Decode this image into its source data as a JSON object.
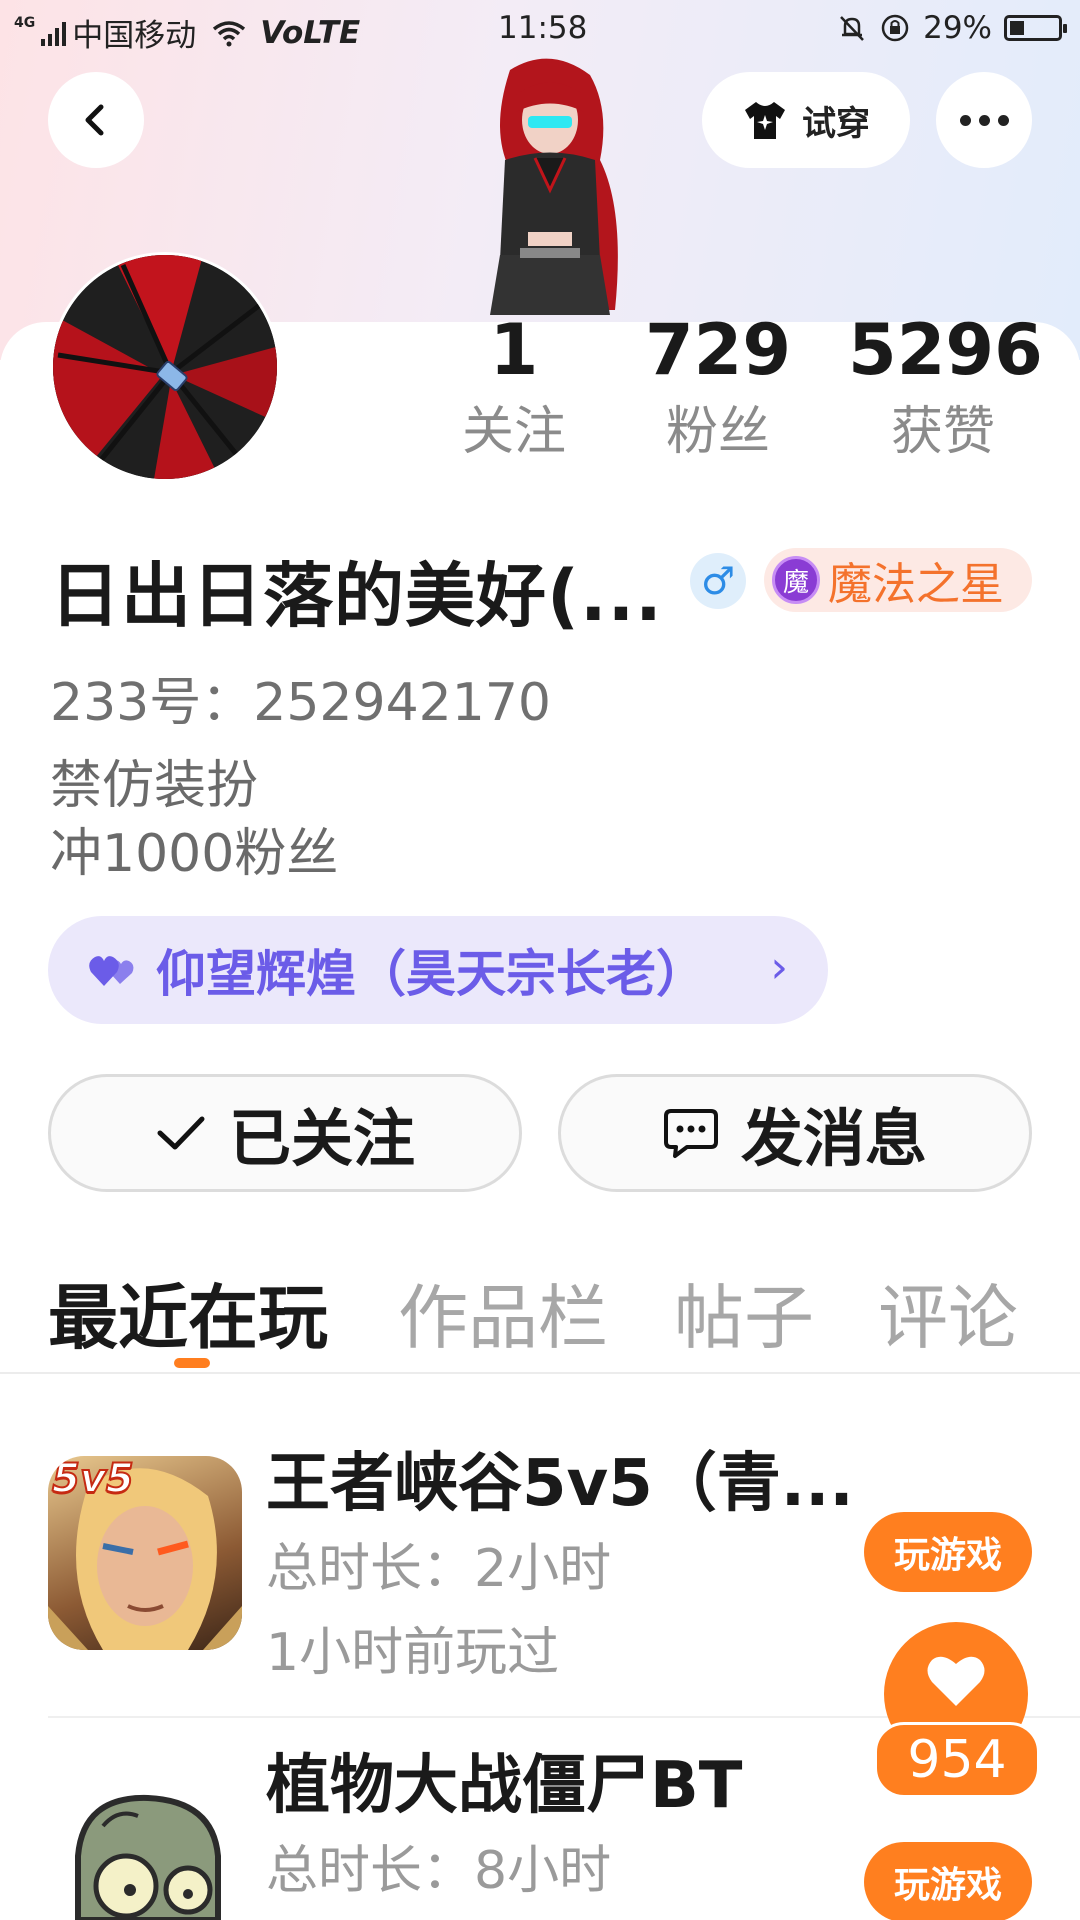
{
  "status_bar": {
    "carrier": "中国移动",
    "network": "4G",
    "volte": "VoLTE",
    "time": "11:58",
    "battery": "29%"
  },
  "header": {
    "tryon_label": "试穿"
  },
  "profile": {
    "stats": [
      {
        "value": "1",
        "label": "关注"
      },
      {
        "value": "729",
        "label": "粉丝"
      },
      {
        "value": "5296",
        "label": "获赞"
      }
    ],
    "name": "日出日落的美好(...",
    "gender_symbol": "♂",
    "badge_icon_text": "魔",
    "badge_label": "魔法之星",
    "uid": "233号：252942170",
    "bio_lines": [
      "禁仿装扮",
      "冲1000粉丝"
    ],
    "title_pill": "仰望辉煌（昊天宗长老）"
  },
  "actions": {
    "follow_label": "已关注",
    "message_label": "发消息"
  },
  "tabs": [
    "最近在玩",
    "作品栏",
    "帖子",
    "评论"
  ],
  "games": [
    {
      "title": "王者峡谷5v5（青...",
      "total_time": "总时长：2小时",
      "last_played": "1小时前玩过",
      "play_label": "玩游戏",
      "icon_text": "5v5"
    },
    {
      "title": "植物大战僵尸BT",
      "total_time": "总时长：8小时",
      "play_label": "玩游戏"
    }
  ],
  "like_float": {
    "count": "954"
  },
  "colors": {
    "accent": "#ff7f1f",
    "title_pill_bg": "#ebe8fb",
    "title_pill_text": "#6b5ce8",
    "badge_text": "#f4722c",
    "gender": "#2d8ce6"
  }
}
